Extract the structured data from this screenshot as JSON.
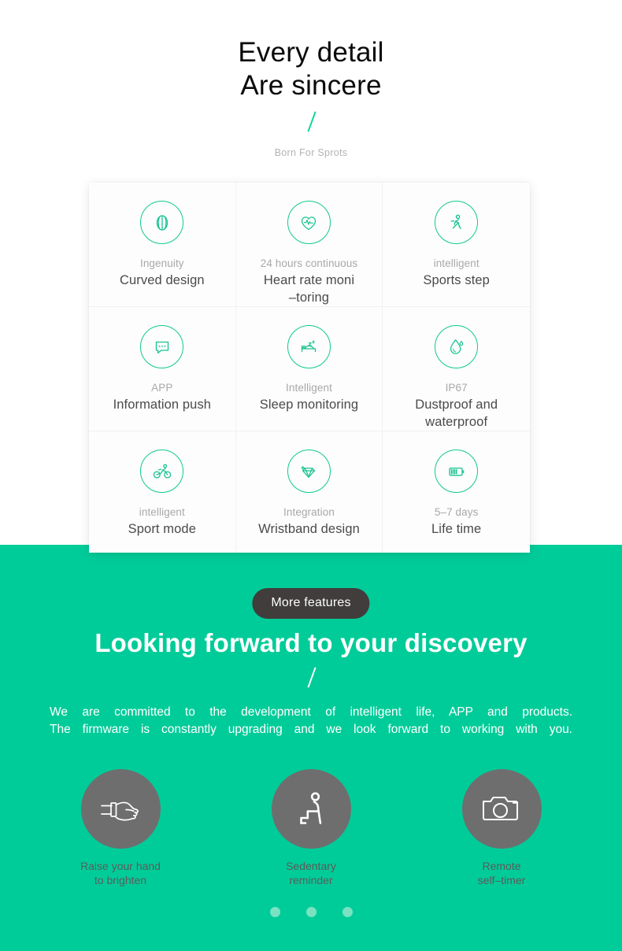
{
  "hero": {
    "title_line1": "Every detail",
    "title_line2": "Are sincere",
    "divider_icon": "slash-divider-icon",
    "subtitle": "Born For Sprots"
  },
  "features": {
    "items": [
      {
        "icon": "curved-watch-icon",
        "caption": "Ingenuity",
        "title": "Curved design"
      },
      {
        "icon": "heart-rate-icon",
        "caption": "24 hours continuous",
        "title": "Heart rate moni",
        "title2": "–toring"
      },
      {
        "icon": "running-person-icon",
        "caption": "intelligent",
        "title": "Sports step"
      },
      {
        "icon": "chat-bubble-icon",
        "caption": "APP",
        "title": "Information push"
      },
      {
        "icon": "sleep-bed-icon",
        "caption": "Intelligent",
        "title": "Sleep monitoring"
      },
      {
        "icon": "water-drop-icon",
        "caption": "IP67",
        "title": "Dustproof and",
        "title2": "waterproof"
      },
      {
        "icon": "bicycle-icon",
        "caption": "intelligent",
        "title": "Sport mode"
      },
      {
        "icon": "diamond-icon",
        "caption": "Integration",
        "title": "Wristband design"
      },
      {
        "icon": "battery-icon",
        "caption": "5–7 days",
        "title": "Life time"
      }
    ]
  },
  "promo": {
    "pill_label": "More features",
    "heading": "Looking forward to your discovery",
    "divider_icon": "slash-divider-icon",
    "body_line1": "We are committed to the development of intelligent life, APP and products.",
    "body_line2": "The firmware is constantly upgrading and we look forward to working with you.",
    "circles": [
      {
        "icon": "wrist-raise-icon",
        "label_line1": "Raise your hand",
        "label_line2": "to brighten"
      },
      {
        "icon": "sedentary-sit-icon",
        "label_line1": "Sedentary",
        "label_line2": "reminder"
      },
      {
        "icon": "camera-icon",
        "label_line1": "Remote",
        "label_line2": "self–timer"
      }
    ],
    "pagination": {
      "count": 3,
      "active_index": 0
    }
  },
  "colors": {
    "brand_green": "#00cc99",
    "icon_green": "#12c98e",
    "pill_dark": "#403d3c",
    "circle_gray": "#6e6e6e",
    "dot_green": "#79e3c1"
  }
}
